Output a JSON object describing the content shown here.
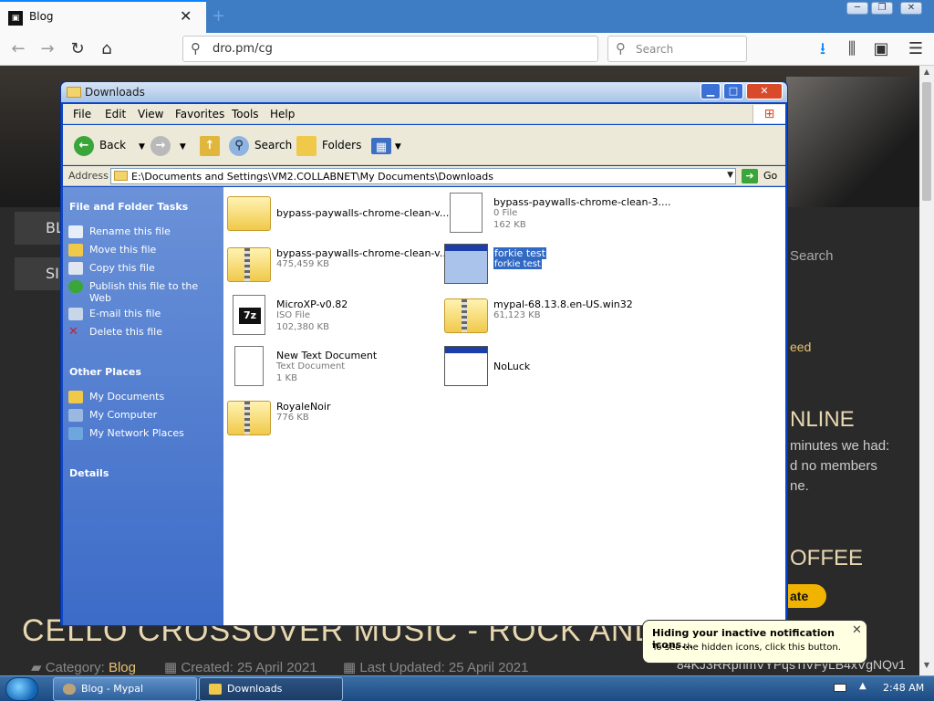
{
  "browser": {
    "tab_title": "Blog",
    "tab_close": "✕",
    "url": "dro.pm/cg",
    "search_placeholder": "Search"
  },
  "webpage": {
    "nav_items": [
      "BL",
      "SI"
    ],
    "side_search": "Search",
    "side_feed": "eed",
    "online_heading": "NLINE",
    "online_line1": "minutes we had:",
    "online_line2": "d no members",
    "online_line3": "ne.",
    "coffee_heading": "OFFEE",
    "donate": "ate",
    "wallet": "84KJ3RRphmVYPqsTiVFyLB4xVgNQv1",
    "post_title": "CELLO CROSSOVER MUSIC - ROCK AND METAL",
    "category_label": "Category:",
    "category_value": "Blog",
    "created": "Created: 25 April 2021",
    "updated": "Last Updated: 25 April 2021"
  },
  "explorer": {
    "title": "Downloads",
    "menu": [
      "File",
      "Edit",
      "View",
      "Favorites",
      "Tools",
      "Help"
    ],
    "toolbar": {
      "back": "Back",
      "search": "Search",
      "folders": "Folders"
    },
    "address_label": "Address",
    "address_path": "E:\\Documents and Settings\\VM2.COLLABNET\\My Documents\\Downloads",
    "go_label": "Go",
    "file_tasks_heading": "File and Folder Tasks",
    "file_tasks": [
      {
        "label": "Rename this file",
        "icon": "rename-icon"
      },
      {
        "label": "Move this file",
        "icon": "move-icon"
      },
      {
        "label": "Copy this file",
        "icon": "copy-icon"
      },
      {
        "label": "Publish this file to the Web",
        "icon": "globe-icon"
      },
      {
        "label": "E-mail this file",
        "icon": "email-icon"
      },
      {
        "label": "Delete this file",
        "icon": "delete-icon"
      }
    ],
    "other_places_heading": "Other Places",
    "other_places": [
      {
        "label": "My Documents",
        "icon": "my-documents-icon"
      },
      {
        "label": "My Computer",
        "icon": "my-computer-icon"
      },
      {
        "label": "My Network Places",
        "icon": "network-icon"
      }
    ],
    "details_heading": "Details",
    "files": [
      {
        "name": "bypass-paywalls-chrome-clean-v...",
        "type": "",
        "size": "",
        "icon": "folder-icon"
      },
      {
        "name": "bypass-paywalls-chrome-clean-3....",
        "type": "0 File",
        "size": "162 KB",
        "icon": "file-icon"
      },
      {
        "name": "bypass-paywalls-chrome-clean-v...",
        "type": "475,459 KB",
        "size": "",
        "icon": "zip-folder-icon"
      },
      {
        "name": "forkie test",
        "type": "forkie test",
        "size": "",
        "icon": "app-window-icon",
        "selected": true
      },
      {
        "name": "MicroXP-v0.82",
        "type": "ISO File",
        "size": "102,380 KB",
        "icon": "7zip-icon"
      },
      {
        "name": "mypal-68.13.8.en-US.win32",
        "type": "61,123 KB",
        "size": "",
        "icon": "zip-folder-icon"
      },
      {
        "name": "New Text Document",
        "type": "Text Document",
        "size": "1 KB",
        "icon": "text-document-icon"
      },
      {
        "name": "NoLuck",
        "type": "",
        "size": "",
        "icon": "app-window-icon"
      },
      {
        "name": "RoyaleNoir",
        "type": "776 KB",
        "size": "",
        "icon": "zip-folder-icon"
      }
    ]
  },
  "balloon": {
    "title": "Hiding your inactive notification icons...",
    "body": "To see the hidden icons, click this button.",
    "close": "✕"
  },
  "taskbar": {
    "tasks": [
      "Blog - Mypal",
      "Downloads"
    ],
    "clock": "2:48 AM"
  }
}
